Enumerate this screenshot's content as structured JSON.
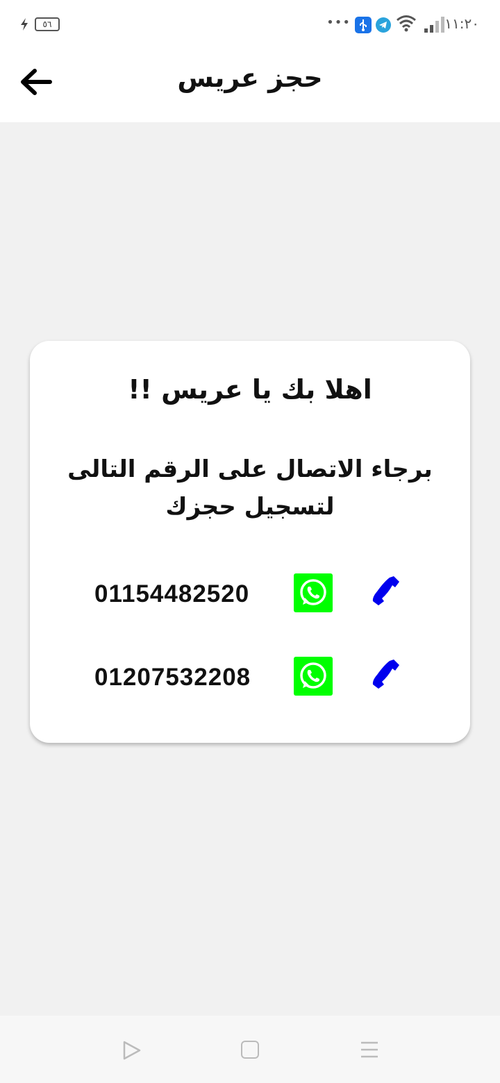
{
  "status_bar": {
    "time": "١١:٢٠",
    "battery": "٥٦",
    "more_dots": "•••",
    "icons": [
      "signal-icon",
      "wifi-icon",
      "telegram-icon",
      "usb-icon",
      "battery-icon",
      "charging-icon"
    ]
  },
  "header": {
    "title": "حجز عريس",
    "back_icon": "arrow-left-icon"
  },
  "card": {
    "welcome": "اهلا بك يا عريس !!",
    "instruction": "برجاء الاتصال على الرقم التالى لتسجيل حجزك",
    "contacts": [
      {
        "number": "01154482520",
        "whatsapp_icon": "whatsapp-icon",
        "call_icon": "phone-icon"
      },
      {
        "number": "01207532208",
        "whatsapp_icon": "whatsapp-icon",
        "call_icon": "phone-icon"
      }
    ]
  },
  "colors": {
    "whatsapp_bg": "#00ff00",
    "call_icon": "#0000ee",
    "page_bg": "#f1f1f1"
  },
  "nav_bar": {
    "icons": [
      "nav-back-icon",
      "nav-home-icon",
      "nav-menu-icon"
    ]
  }
}
